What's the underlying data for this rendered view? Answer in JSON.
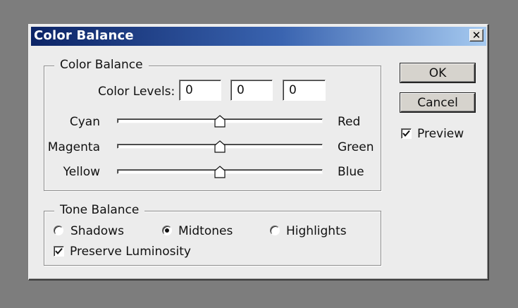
{
  "dialog": {
    "title": "Color Balance",
    "close_glyph": "✕",
    "close_icon": "close-icon"
  },
  "color_balance": {
    "group_label": "Color Balance",
    "levels_label": "Color Levels:",
    "levels": [
      "0",
      "0",
      "0"
    ],
    "sliders": [
      {
        "left": "Cyan",
        "right": "Red",
        "value": 0,
        "min": -100,
        "max": 100
      },
      {
        "left": "Magenta",
        "right": "Green",
        "value": 0,
        "min": -100,
        "max": 100
      },
      {
        "left": "Yellow",
        "right": "Blue",
        "value": 0,
        "min": -100,
        "max": 100
      }
    ]
  },
  "tone_balance": {
    "group_label": "Tone Balance",
    "options": [
      {
        "label": "Shadows",
        "selected": false
      },
      {
        "label": "Midtones",
        "selected": true
      },
      {
        "label": "Highlights",
        "selected": false
      }
    ],
    "preserve_label": "Preserve Luminosity",
    "preserve_checked": true
  },
  "buttons": {
    "ok": "OK",
    "cancel": "Cancel"
  },
  "preview": {
    "label": "Preview",
    "checked": true
  },
  "colors": {
    "title_gradient_start": "#0c2466",
    "title_gradient_end": "#a6caf0",
    "dialog_bg": "#ececec",
    "desktop_bg": "#7d7d7d"
  }
}
